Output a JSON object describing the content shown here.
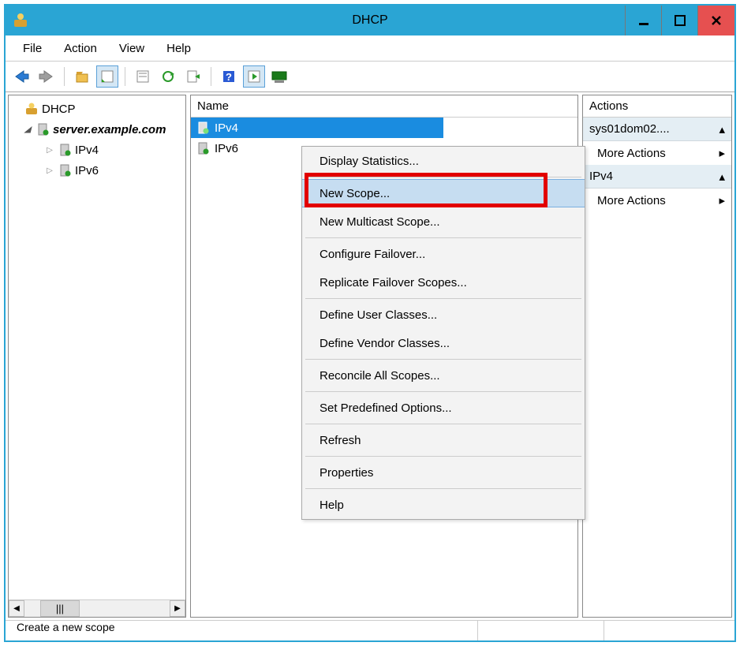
{
  "window": {
    "title": "DHCP"
  },
  "menubar": [
    "File",
    "Action",
    "View",
    "Help"
  ],
  "tree": {
    "root": "DHCP",
    "server": "server.example.com",
    "items": [
      "IPv4",
      "IPv6"
    ]
  },
  "main": {
    "column_header": "Name",
    "rows": [
      "IPv4",
      "IPv6"
    ]
  },
  "context_menu": [
    "Display Statistics...",
    "New Scope...",
    "New Multicast Scope...",
    "Configure Failover...",
    "Replicate Failover Scopes...",
    "Define User Classes...",
    "Define Vendor Classes...",
    "Reconcile All Scopes...",
    "Set Predefined Options...",
    "Refresh",
    "Properties",
    "Help"
  ],
  "actions": {
    "header": "Actions",
    "sections": [
      {
        "title": "sys01dom02....",
        "items": [
          "More Actions"
        ]
      },
      {
        "title": "IPv4",
        "items": [
          "More Actions"
        ]
      }
    ]
  },
  "statusbar": {
    "text": "Create a new scope"
  }
}
